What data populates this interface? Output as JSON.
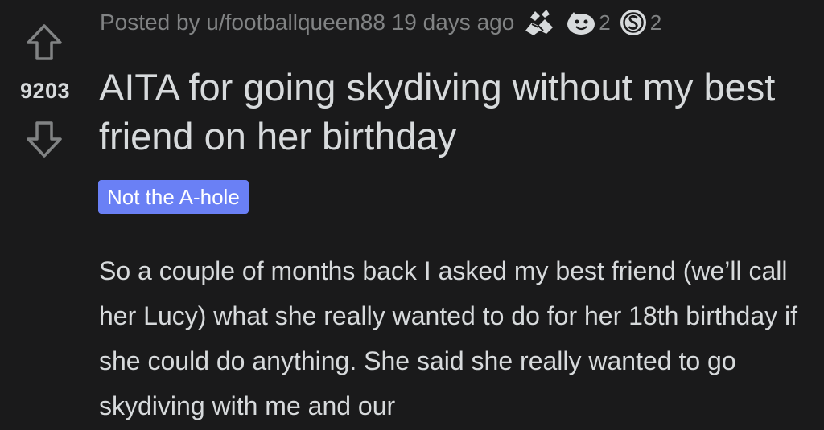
{
  "post": {
    "meta": {
      "posted_by": "Posted by u/footballqueen88 19 days ago",
      "awards": [
        {
          "icon": "handshake-award-icon",
          "count": ""
        },
        {
          "icon": "wholesome-award-icon",
          "count": "2"
        },
        {
          "icon": "silver-coin-award-icon",
          "count": "2"
        }
      ]
    },
    "score": "9203",
    "title": "AITA for going skydiving without my best friend on her birthday",
    "flair": "Not the A-hole",
    "body": "So a couple of months back I asked my best friend (we’ll call her Lucy) what she really wanted to do for her 18th birthday if she could do anything. She said she really wanted to go skydiving with me and our"
  },
  "colors": {
    "background": "#1a1a1b",
    "text": "#d7dadc",
    "meta_text": "#818384",
    "flair_bg": "#6a80f5",
    "flair_text": "#ffffff"
  }
}
